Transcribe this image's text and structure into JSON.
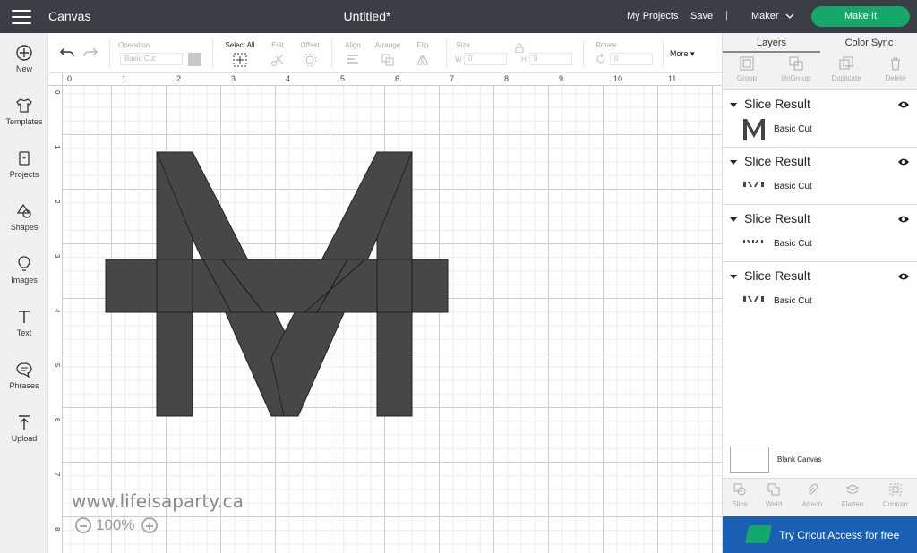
{
  "topbar": {
    "app_title": "Canvas",
    "doc_title": "Untitled*",
    "my_projects": "My Projects",
    "save": "Save",
    "separator": "|",
    "machine": "Maker",
    "make_it": "Make It"
  },
  "nav": {
    "new": "New",
    "templates": "Templates",
    "projects": "Projects",
    "shapes": "Shapes",
    "images": "Images",
    "text": "Text",
    "phrases": "Phrases",
    "upload": "Upload"
  },
  "toolbar": {
    "operation": "Operation",
    "operation_value": "Basic Cut",
    "select_all": "Select All",
    "edit": "Edit",
    "offset": "Offset",
    "align": "Align",
    "arrange": "Arrange",
    "flip": "Flip",
    "size": "Size",
    "size_w": "W",
    "size_w_val": "0",
    "size_h": "H",
    "size_h_val": "0",
    "rotate": "Rotate",
    "rotate_val": "0",
    "more": "More"
  },
  "ruler": {
    "top": [
      "0",
      "1",
      "2",
      "3",
      "4",
      "5",
      "6",
      "7",
      "8",
      "9",
      "10",
      "11"
    ],
    "left": [
      "0",
      "1",
      "2",
      "3",
      "4",
      "5",
      "6",
      "7",
      "8"
    ]
  },
  "watermark": "www.lifeisaparty.ca",
  "zoom": "100%",
  "panel": {
    "tabs": [
      "Layers",
      "Color Sync"
    ],
    "tools": [
      "Group",
      "UnGroup",
      "Duplicate",
      "Delete"
    ],
    "layers": [
      {
        "title": "Slice Result",
        "label": "Basic Cut"
      },
      {
        "title": "Slice Result",
        "label": "Basic Cut"
      },
      {
        "title": "Slice Result",
        "label": "Basic Cut"
      },
      {
        "title": "Slice Result",
        "label": "Basic Cut"
      }
    ],
    "blank_canvas": "Blank Canvas",
    "bottom_tools": [
      "Slice",
      "Weld",
      "Attach",
      "Flatten",
      "Contour"
    ],
    "cricut_access": "Try Cricut Access for free"
  },
  "colors": {
    "topbar": "#3a3f45",
    "make_it": "#15a86a",
    "shape_fill": "#474747",
    "cricut_access": "#1a5fb4"
  }
}
